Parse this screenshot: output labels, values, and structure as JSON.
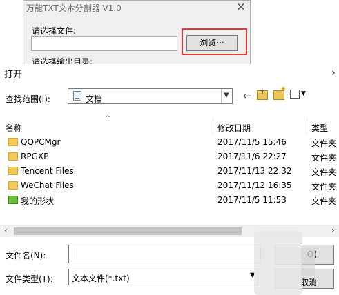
{
  "splitter_window": {
    "title": "万能TXT文本分割器  V1.0",
    "close_glyph": "✕",
    "file_label": "请选择文件:",
    "browse_label": "浏览···",
    "output_label": "请选择输出目录:"
  },
  "dialog": {
    "title": "打开",
    "look_in_label": "查找范围(I):",
    "look_in_value": "文档",
    "columns": {
      "name": "名称",
      "date": "修改日期",
      "type": "类型"
    },
    "sort_glyph": "^",
    "rows": [
      {
        "name": "QQPCMgr",
        "date": "2017/11/5 15:46",
        "type": "文件夹"
      },
      {
        "name": "RPGXP",
        "date": "2017/11/6 22:27",
        "type": "文件夹"
      },
      {
        "name": "Tencent Files",
        "date": "2017/11/13 22:32",
        "type": "文件夹"
      },
      {
        "name": "WeChat Files",
        "date": "2017/11/12 16:35",
        "type": "文件夹"
      },
      {
        "name": "我的形状",
        "date": "2017/11/5 11:53",
        "type": "文件夹"
      }
    ],
    "file_name_label": "文件名(N):",
    "file_name_value": "",
    "file_type_label": "文件类型(T):",
    "file_type_value": "文本文件(*.txt)",
    "open_label": "O)",
    "cancel_label": "取消"
  },
  "colors": {
    "highlight_border": "#e53935",
    "folder": "#f5cc5a"
  },
  "icons": [
    "close-icon",
    "document-icon",
    "back-icon",
    "up-folder-icon",
    "new-folder-icon",
    "view-menu-icon",
    "folder-icon",
    "shape-icon"
  ]
}
